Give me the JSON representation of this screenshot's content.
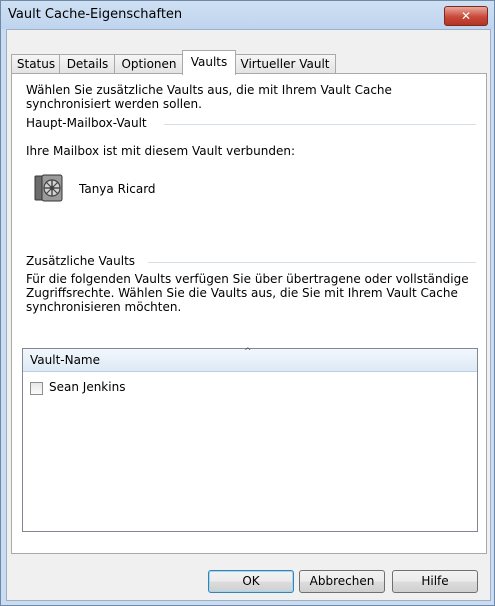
{
  "window": {
    "title": "Vault Cache-Eigenschaften",
    "close_glyph": "✕"
  },
  "tabs": [
    {
      "label": "Status"
    },
    {
      "label": "Details"
    },
    {
      "label": "Optionen"
    },
    {
      "label": "Vaults",
      "active": true
    },
    {
      "label": "Virtueller Vault"
    }
  ],
  "vaults_page": {
    "intro_line1": "Wählen Sie zusätzliche Vaults aus, die mit Ihrem Vault Cache",
    "intro_line2": "synchronisiert werden sollen.",
    "main_group_label": "Haupt-Mailbox-Vault",
    "mailbox_text": "Ihre Mailbox ist mit diesem Vault verbunden:",
    "vault_icon": "vault-safe-icon",
    "mailbox_owner": "Tanya Ricard",
    "additional_group_label": "Zusätzliche Vaults",
    "additional_line1": "Für die folgenden Vaults verfügen Sie über übertragene oder vollständige",
    "additional_line2": "Zugriffsrechte. Wählen Sie die Vaults aus, die Sie mit Ihrem Vault Cache",
    "additional_line3": "synchronisieren möchten.",
    "list": {
      "column_header": "Vault-Name",
      "sort_glyph": "^",
      "rows": [
        {
          "name": "Sean Jenkins",
          "checked": false
        }
      ]
    }
  },
  "buttons": {
    "ok": "OK",
    "cancel": "Abbrechen",
    "help": "Hilfe"
  },
  "colors": {
    "title_bar": "#c9dcf1",
    "close_button": "#c8493a",
    "default_button_border": "#3c7fb1"
  }
}
